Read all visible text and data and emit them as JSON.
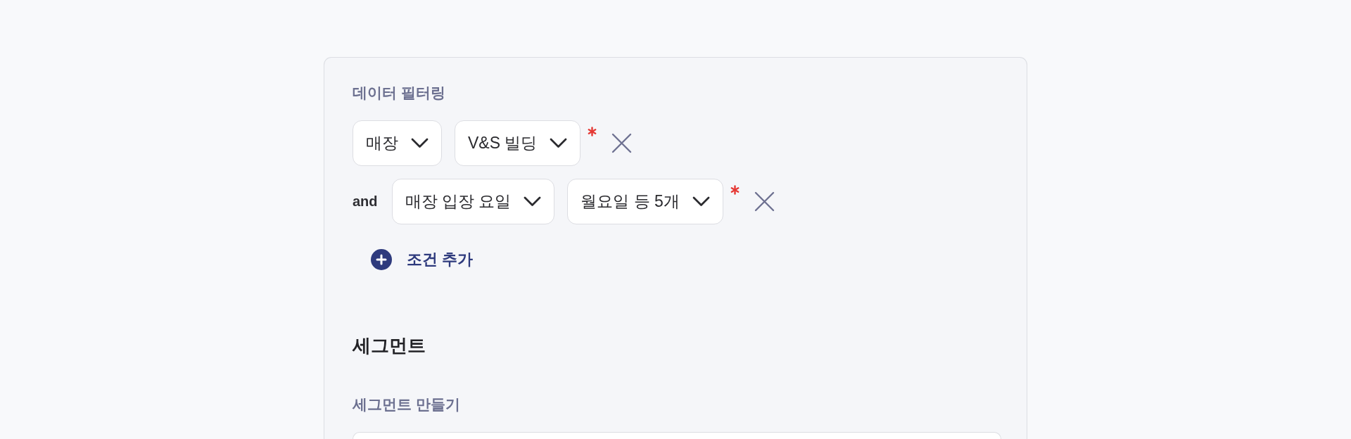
{
  "filter_section": {
    "title": "데이터 필터링",
    "conditions": [
      {
        "field": "매장",
        "value": "V&S 빌딩",
        "required": true
      },
      {
        "connector": "and",
        "field": "매장 입장 요일",
        "value": "월요일 등 5개",
        "required": true
      }
    ],
    "add_button": {
      "label": "조건 추가"
    }
  },
  "segment_section": {
    "title": "세그먼트",
    "create_label": "세그먼트 만들기"
  }
}
